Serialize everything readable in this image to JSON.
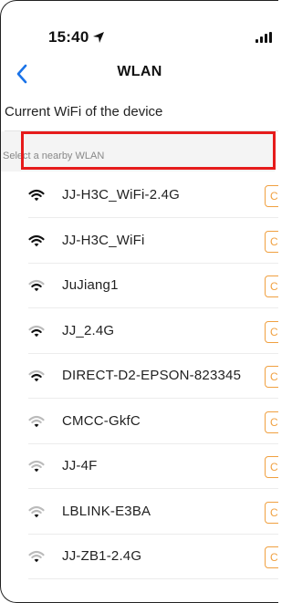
{
  "status_bar": {
    "time": "15:40"
  },
  "nav": {
    "title": "WLAN"
  },
  "current": {
    "label": "Current WiFi of the device"
  },
  "select": {
    "label": "Select a nearby WLAN"
  },
  "colors": {
    "accent": "#f0a040",
    "back": "#1a73e8",
    "highlight": "#e61b1b"
  },
  "networks": [
    {
      "ssid": "JJ-H3C_WiFi-2.4G",
      "signal": "strong",
      "button": "C"
    },
    {
      "ssid": "JJ-H3C_WiFi",
      "signal": "strong",
      "button": "C"
    },
    {
      "ssid": "JuJiang1",
      "signal": "medium",
      "button": "C"
    },
    {
      "ssid": "JJ_2.4G",
      "signal": "medium",
      "button": "C"
    },
    {
      "ssid": "DIRECT-D2-EPSON-823345",
      "signal": "medium",
      "button": "C"
    },
    {
      "ssid": "CMCC-GkfC",
      "signal": "weak",
      "button": "C"
    },
    {
      "ssid": "JJ-4F",
      "signal": "weak",
      "button": "C"
    },
    {
      "ssid": "LBLINK-E3BA",
      "signal": "weak",
      "button": "C"
    },
    {
      "ssid": "JJ-ZB1-2.4G",
      "signal": "weak",
      "button": "C"
    }
  ]
}
